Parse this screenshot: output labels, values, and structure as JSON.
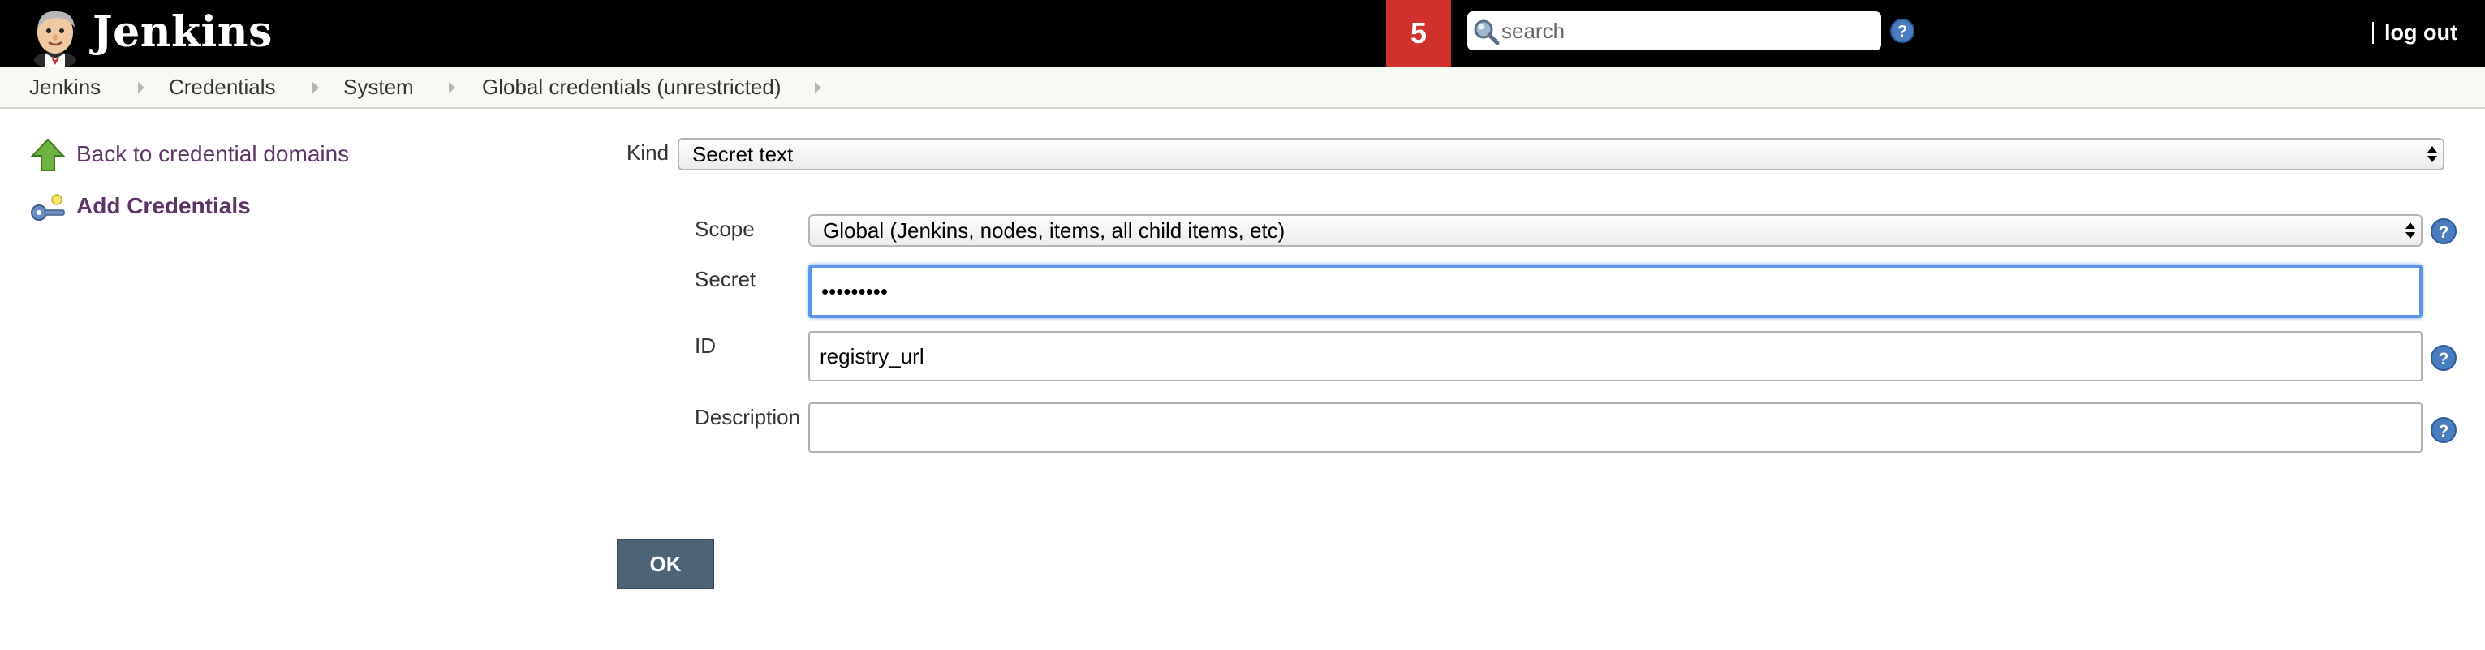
{
  "header": {
    "brand": "Jenkins",
    "notification_count": "5",
    "search": {
      "placeholder": "search",
      "value": ""
    },
    "separator": "|",
    "logout_label": "log out"
  },
  "breadcrumbs": [
    {
      "label": "Jenkins"
    },
    {
      "label": "Credentials"
    },
    {
      "label": "System"
    },
    {
      "label": "Global credentials (unrestricted)"
    }
  ],
  "side_panel": {
    "back_link": "Back to credential domains",
    "add_link": "Add Credentials"
  },
  "form": {
    "kind": {
      "label": "Kind",
      "value": "Secret text"
    },
    "scope": {
      "label": "Scope",
      "value": "Global (Jenkins, nodes, items, all child items, etc)"
    },
    "secret": {
      "label": "Secret",
      "value": "•••••••••"
    },
    "id": {
      "label": "ID",
      "value": "registry_url"
    },
    "description": {
      "label": "Description",
      "value": ""
    },
    "ok_label": "OK"
  },
  "colors": {
    "header_bg": "#000000",
    "notification_bg": "#d0312a",
    "link": "#5c3566",
    "focus_border": "#5d96e8",
    "ok_button": "#4b6576"
  },
  "icons": {
    "logo": "jenkins-butler-icon",
    "search": "magnifier-icon",
    "help": "question-circle-icon",
    "back": "green-up-arrow-icon",
    "add": "key-icon"
  }
}
